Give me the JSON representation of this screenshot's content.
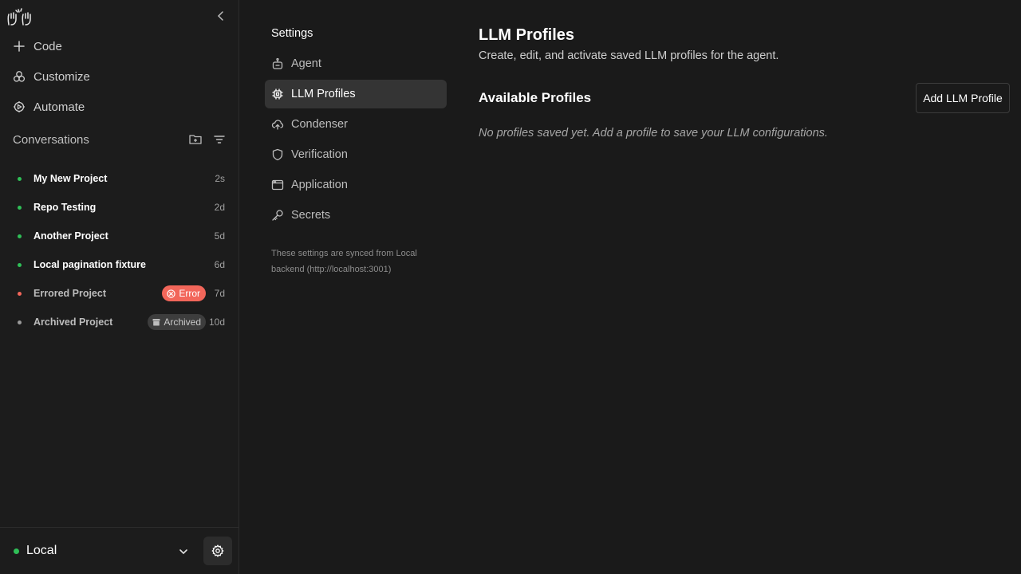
{
  "sidebar": {
    "logo_icon": "hands-logo-icon",
    "nav": [
      {
        "label": "Code",
        "icon": "plus-icon"
      },
      {
        "label": "Customize",
        "icon": "shapes-icon"
      },
      {
        "label": "Automate",
        "icon": "automate-icon"
      }
    ],
    "conversations_title": "Conversations",
    "conversations": [
      {
        "name": "My New Project",
        "age": "2s",
        "status": "running",
        "status_color": "#2fbf57"
      },
      {
        "name": "Repo Testing",
        "age": "2d",
        "status": "running",
        "status_color": "#2fbf57"
      },
      {
        "name": "Another Project",
        "age": "5d",
        "status": "running",
        "status_color": "#2fbf57"
      },
      {
        "name": "Local pagination fixture",
        "age": "6d",
        "status": "running",
        "status_color": "#2fbf57"
      },
      {
        "name": "Errored Project",
        "age": "7d",
        "status": "error",
        "status_color": "#f2665a",
        "badge": "Error"
      },
      {
        "name": "Archived Project",
        "age": "10d",
        "status": "archived",
        "status_color": "#9a9a9a",
        "badge": "Archived"
      }
    ],
    "footer": {
      "backend": "Local",
      "status_color": "#2fbf57"
    }
  },
  "settings_nav": {
    "title": "Settings",
    "items": [
      {
        "label": "Agent",
        "icon": "robot-icon"
      },
      {
        "label": "LLM Profiles",
        "icon": "chip-icon",
        "active": true
      },
      {
        "label": "Condenser",
        "icon": "cloud-upload-icon"
      },
      {
        "label": "Verification",
        "icon": "shield-icon"
      },
      {
        "label": "Application",
        "icon": "window-icon"
      },
      {
        "label": "Secrets",
        "icon": "key-icon"
      }
    ],
    "sync_note": "These settings are synced from Local backend (http://localhost:3001)"
  },
  "main": {
    "title": "LLM Profiles",
    "description": "Create, edit, and activate saved LLM profiles for the agent.",
    "section_title": "Available Profiles",
    "add_button": "Add LLM Profile",
    "empty_message": "No profiles saved yet. Add a profile to save your LLM configurations."
  }
}
